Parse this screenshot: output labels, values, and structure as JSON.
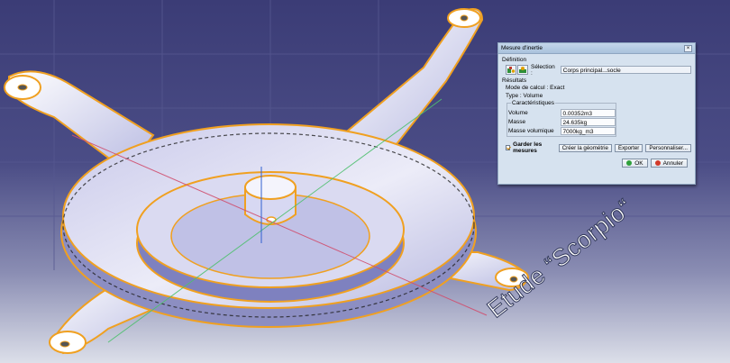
{
  "dialog": {
    "title": "Mesure d'inertie",
    "close_glyph": "×",
    "definition_label": "Définition",
    "selection_label": "Sélection :",
    "selection_value": "Corps principal...socle",
    "results_label": "Résultats",
    "calc_mode_label": "Mode de calcul :",
    "calc_mode_value": "Exact",
    "type_label": "Type :",
    "type_value": "Volume",
    "characteristics_label": "Caractéristiques",
    "rows": [
      {
        "label": "Volume",
        "value": "0.00352m3"
      },
      {
        "label": "Masse",
        "value": "24.635kg"
      },
      {
        "label": "Masse volumique",
        "value": "7000kg_m3"
      }
    ],
    "keep_measures_label": "Garder les mesures",
    "keep_measures_checked": true,
    "create_geometry_button": "Créer la géométrie",
    "export_button": "Exporter",
    "customize_button": "Personnaliser...",
    "ok_button": "OK",
    "cancel_button": "Annuler"
  },
  "watermark_text": "Etude “Scorpio“",
  "colors": {
    "background_top": "#3c3d78",
    "background_bottom": "#d9dce8",
    "model_orange": "#f0a020",
    "dialog_bg": "#d6e2ef"
  },
  "icons": [
    "inertia-icon",
    "inertia-surface-icon",
    "ok-icon",
    "cancel-icon"
  ]
}
